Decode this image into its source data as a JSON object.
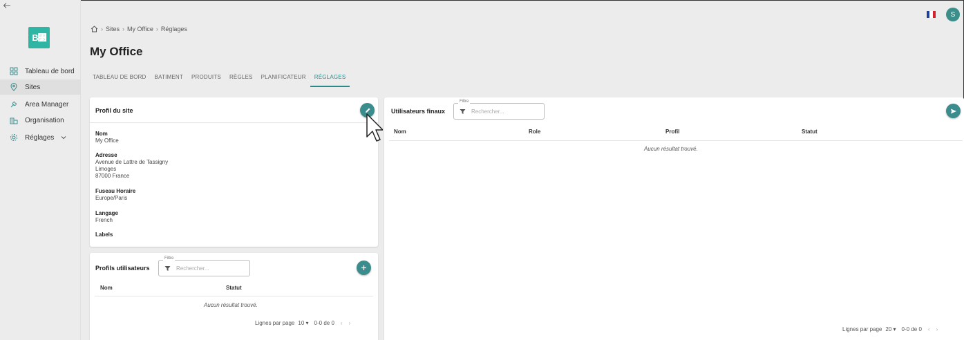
{
  "app": {
    "logo_text": "B⃳",
    "accent_color": "#3b8c8c",
    "brand_color": "#2eb5a3"
  },
  "sidebar": {
    "items": [
      {
        "label": "Tableau de bord",
        "icon": "dashboard-icon"
      },
      {
        "label": "Sites",
        "icon": "location-pin-icon"
      },
      {
        "label": "Area Manager",
        "icon": "wrench-icon"
      },
      {
        "label": "Organisation",
        "icon": "buildings-icon"
      },
      {
        "label": "Réglages",
        "icon": "gear-icon"
      }
    ]
  },
  "header": {
    "breadcrumb": [
      "Sites",
      "My Office",
      "Réglages"
    ],
    "title": "My Office",
    "avatar_initial": "S",
    "language_flag": "french-flag"
  },
  "tabs": [
    "TABLEAU DE BORD",
    "BATIMENT",
    "PRODUITS",
    "RÈGLES",
    "PLANIFICATEUR",
    "RÉGLAGES"
  ],
  "site_profile": {
    "title": "Profil du site",
    "fields": {
      "nom_label": "Nom",
      "nom_value": "My Office",
      "adresse_label": "Adresse",
      "adresse_line1": "Avenue de Lattre de Tassigny",
      "adresse_line2": "Limoges",
      "adresse_line3": "87000 France",
      "fuseau_label": "Fuseau Horaire",
      "fuseau_value": "Europe/Paris",
      "langage_label": "Langage",
      "langage_value": "French",
      "labels_label": "Labels"
    }
  },
  "user_profiles": {
    "title": "Profils utilisateurs",
    "filter_legend": "Filtre",
    "filter_placeholder": "Rechercher...",
    "columns": [
      "Nom",
      "Statut"
    ],
    "empty_text": "Aucun résultat trouvé.",
    "pager": {
      "rows_label": "Lignes par page",
      "rows_value": "10",
      "range": "0-0 de 0"
    }
  },
  "end_users": {
    "title": "Utilisateurs finaux",
    "filter_legend": "Filtre",
    "filter_placeholder": "Rechercher...",
    "columns": [
      "Nom",
      "Role",
      "Profil",
      "Statut"
    ],
    "empty_text": "Aucun résultat trouvé.",
    "pager": {
      "rows_label": "Lignes par page",
      "rows_value": "20",
      "range": "0-0 de 0"
    }
  }
}
